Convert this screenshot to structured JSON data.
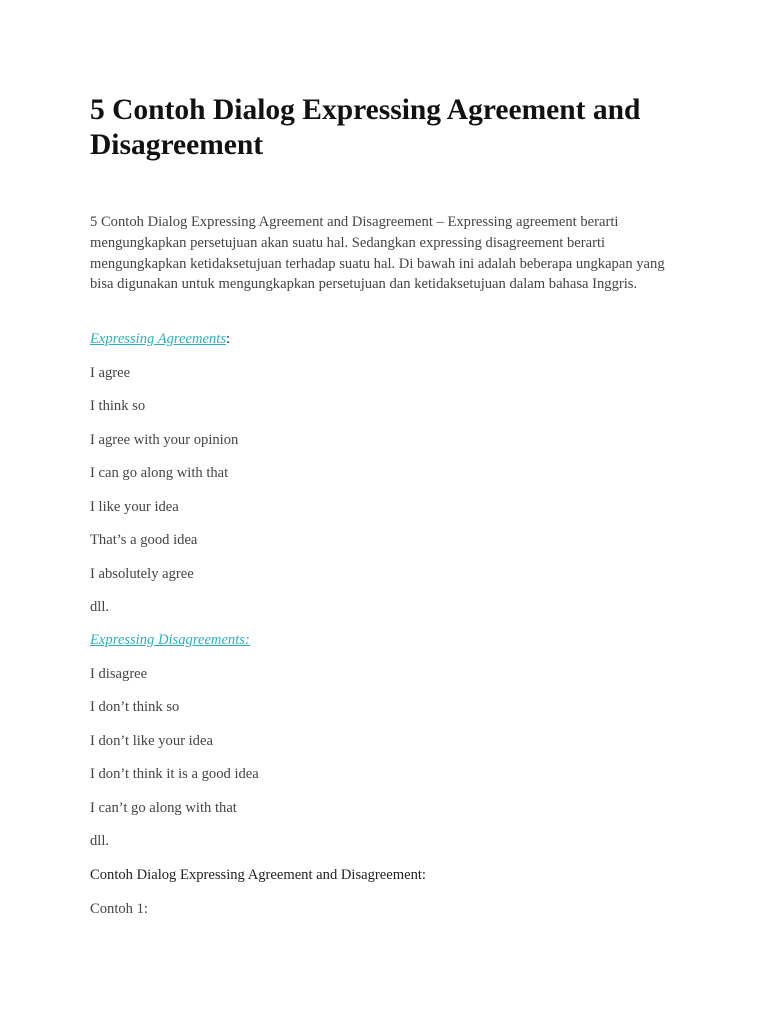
{
  "article": {
    "title": "5 Contoh Dialog Expressing Agreement and Disagreement",
    "intro": "5 Contoh Dialog Expressing Agreement and Disagreement – Expressing agreement berarti mengungkapkan persetujuan akan suatu hal. Sedangkan expressing disagreement berarti mengungkapkan ketidaksetujuan terhadap suatu hal. Di bawah ini adalah beberapa ungkapan yang bisa digunakan untuk mengungkapkan persetujuan dan ketidaksetujuan dalam bahasa Inggris.",
    "agreements": {
      "heading_link": "Expressing Agreements",
      "heading_suffix": ":",
      "items": [
        "I agree",
        "I think so",
        "I agree with your opinion",
        "I can go along with that",
        "I like your idea",
        "That’s a good idea",
        "I absolutely agree",
        "dll."
      ]
    },
    "disagreements": {
      "heading_link": "Expressing Disagreements:",
      "items": [
        "I disagree",
        "I don’t think so",
        "I don’t like your idea",
        "I don’t think it is a good idea",
        "I can’t go along with that",
        "dll."
      ]
    },
    "dialog_heading": "Contoh Dialog Expressing Agreement and Disagreement:",
    "example_label": "Contoh 1:"
  },
  "colors": {
    "link": "#2ab0bc",
    "text": "#444444",
    "title": "#111111"
  }
}
